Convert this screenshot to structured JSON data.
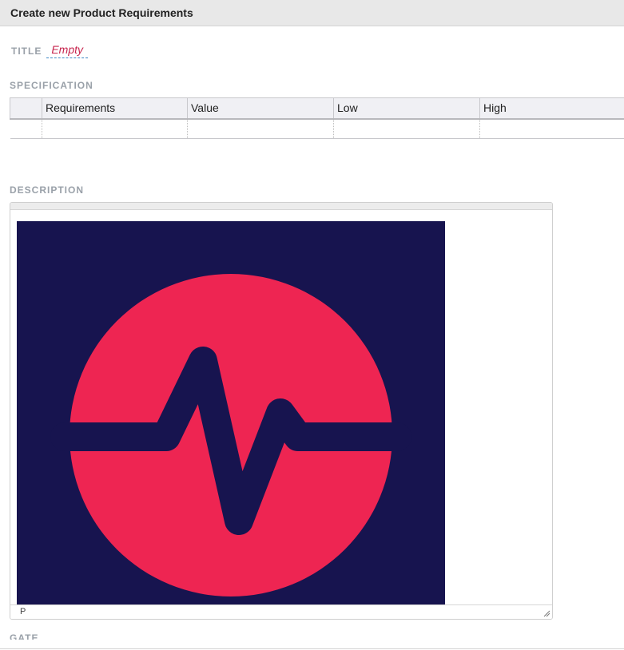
{
  "dialog": {
    "title": "Create new Product Requirements"
  },
  "title_field": {
    "label": "TITLE",
    "value": "Empty"
  },
  "specification": {
    "label": "SPECIFICATION",
    "columns": [
      "",
      "Requirements",
      "Value",
      "Low",
      "High"
    ]
  },
  "description": {
    "label": "DESCRIPTION",
    "status_path": "P",
    "image": {
      "background": "#17144f",
      "circle": "#ee2552",
      "pulse": "#17144f"
    }
  },
  "gate": {
    "label": "GATE"
  }
}
